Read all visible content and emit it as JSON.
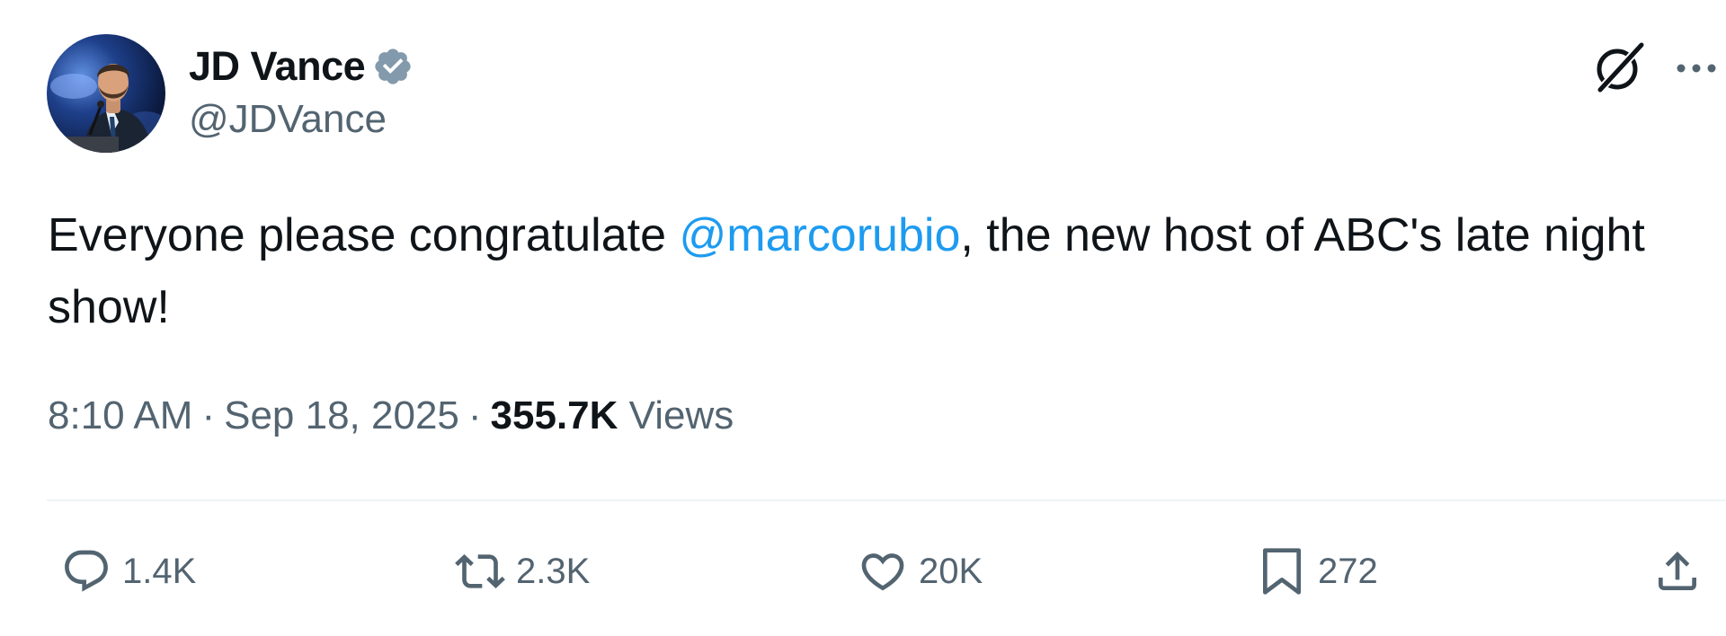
{
  "author": {
    "display_name": "JD Vance",
    "handle": "@JDVance",
    "verified": true
  },
  "tweet": {
    "text_before": "Everyone please congratulate ",
    "mention": "@marcorubio",
    "text_after": ", the new host of ABC's late night show!"
  },
  "meta": {
    "time": "8:10 AM",
    "separator": "·",
    "date": "Sep 18, 2025",
    "views_count": "355.7K",
    "views_label": "Views"
  },
  "actions": {
    "replies": "1.4K",
    "reposts": "2.3K",
    "likes": "20K",
    "bookmarks": "272"
  },
  "icons": {
    "verified": "verified-badge-icon",
    "grok": "grok-icon",
    "more": "more-options-icon",
    "reply": "reply-icon",
    "repost": "repost-icon",
    "like": "like-icon",
    "bookmark": "bookmark-icon",
    "share": "share-icon"
  },
  "colors": {
    "mention": "#1d9bf0",
    "secondary_text": "#536471",
    "primary_text": "#0f1419",
    "verified_badge": "#829aab"
  }
}
